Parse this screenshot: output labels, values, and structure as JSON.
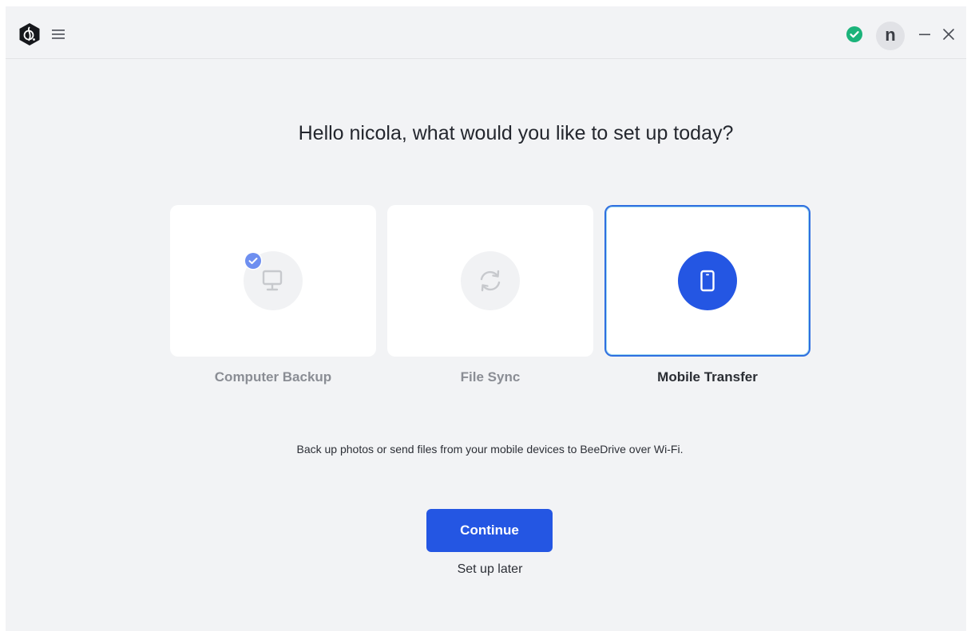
{
  "app": {
    "logo_icon": "beedrive-logo-icon",
    "menu_icon": "hamburger-menu-icon",
    "status_icon": "check-circle-icon",
    "status_color": "#1bb37a",
    "avatar_initial": "n",
    "minimize_glyph": "–",
    "close_glyph": "×"
  },
  "main": {
    "headline": "Hello nicola, what would you like to set up today?",
    "options": [
      {
        "label": "Computer Backup",
        "icon": "monitor-icon",
        "selected": false,
        "badge": "check-badge-icon"
      },
      {
        "label": "File Sync",
        "icon": "sync-icon",
        "selected": false
      },
      {
        "label": "Mobile Transfer",
        "icon": "mobile-phone-icon",
        "selected": true
      }
    ],
    "description": "Back up photos or send files from your mobile devices to BeeDrive over Wi-Fi.",
    "continue_label": "Continue",
    "later_label": "Set up later"
  },
  "colors": {
    "accent": "#2456e3",
    "background": "#f2f3f5",
    "selected_border": "#2f6fe0"
  }
}
